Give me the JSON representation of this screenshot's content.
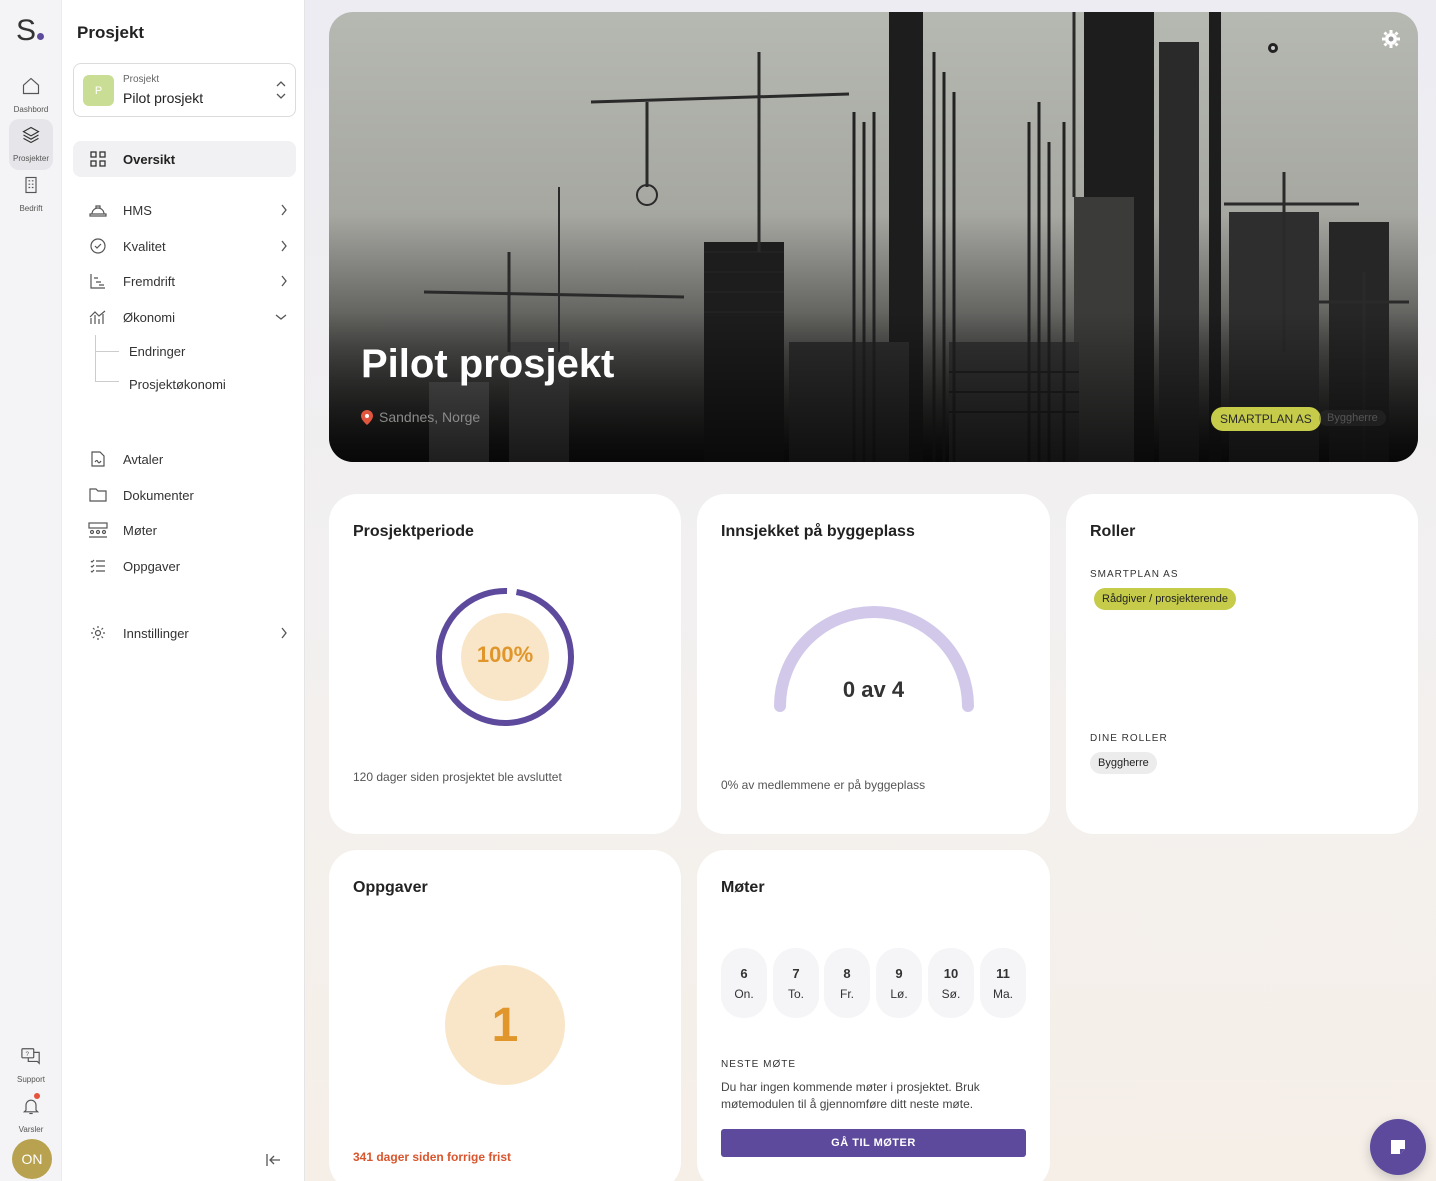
{
  "rail": {
    "logo": "S",
    "items": [
      {
        "label": "Dashbord",
        "icon": "home-icon"
      },
      {
        "label": "Prosjekter",
        "icon": "layers-icon"
      },
      {
        "label": "Bedrift",
        "icon": "building-icon"
      }
    ],
    "bottom": [
      {
        "label": "Support",
        "icon": "support-chat-icon"
      },
      {
        "label": "Varsler",
        "icon": "bell-icon"
      }
    ],
    "avatar": "ON"
  },
  "sidenav": {
    "title": "Prosjekt",
    "project_selector": {
      "small_label": "Prosjekt",
      "name": "Pilot prosjekt",
      "badge": "P"
    },
    "items": [
      {
        "label": "Oversikt",
        "icon": "grid-icon"
      },
      {
        "label": "HMS",
        "icon": "hard-hat-icon"
      },
      {
        "label": "Kvalitet",
        "icon": "check-badge-icon"
      },
      {
        "label": "Fremdrift",
        "icon": "gantt-icon"
      },
      {
        "label": "Økonomi",
        "icon": "chart-bars-icon"
      },
      {
        "label": "Avtaler",
        "icon": "contract-icon"
      },
      {
        "label": "Dokumenter",
        "icon": "folder-icon"
      },
      {
        "label": "Møter",
        "icon": "meeting-icon"
      },
      {
        "label": "Oppgaver",
        "icon": "checklist-icon"
      },
      {
        "label": "Innstillinger",
        "icon": "gear-icon"
      }
    ],
    "sub_items": [
      "Endringer",
      "Prosjektøkonomi"
    ]
  },
  "hero": {
    "title": "Pilot prosjekt",
    "location": "Sandnes, Norge",
    "company_badge": "SMARTPLAN AS",
    "role_badge": "Byggherre"
  },
  "cards": {
    "period": {
      "title": "Prosjektperiode",
      "percent": "100%",
      "progress": 1.0,
      "caption": "120 dager siden prosjektet ble avsluttet"
    },
    "checkin": {
      "title": "Innsjekket på byggeplass",
      "value": "0 av 4",
      "fraction": 0.0,
      "caption": "0% av medlemmene er på byggeplass"
    },
    "roles": {
      "title": "Roller",
      "company_label": "SMARTPLAN AS",
      "company_role": "Rådgiver / prosjekterende",
      "your_label": "DINE ROLLER",
      "your_role": "Byggherre"
    },
    "tasks": {
      "title": "Oppgaver",
      "count": "1",
      "caption": "341 dager siden forrige frist"
    },
    "meetings": {
      "title": "Møter",
      "days": [
        {
          "n": "6",
          "w": "On."
        },
        {
          "n": "7",
          "w": "To."
        },
        {
          "n": "8",
          "w": "Fr."
        },
        {
          "n": "9",
          "w": "Lø."
        },
        {
          "n": "10",
          "w": "Sø."
        },
        {
          "n": "11",
          "w": "Ma."
        }
      ],
      "next_label": "NESTE MØTE",
      "next_text": "Du har ingen kommende møter i prosjektet. Bruk møtemodulen til å gjennomføre ditt neste møte.",
      "button": "GÅ TIL MØTER"
    }
  },
  "colors": {
    "accent": "#5d4a9c",
    "orange": "#e0962a",
    "lime": "#c6cc4a",
    "alert": "#d9552d"
  }
}
